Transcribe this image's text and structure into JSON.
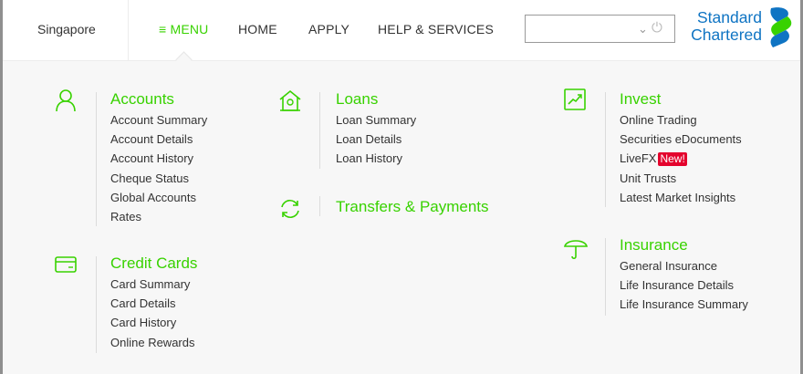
{
  "header": {
    "region": "Singapore",
    "menu_label": "≡ MENU",
    "home_label": "HOME",
    "apply_label": "APPLY",
    "help_label": "HELP & SERVICES",
    "select_value": "",
    "logo_line1": "Standard",
    "logo_line2": "Chartered"
  },
  "accounts": {
    "title": "Accounts",
    "items": [
      "Account Summary",
      "Account Details",
      "Account History",
      "Cheque Status",
      "Global Accounts",
      "Rates"
    ]
  },
  "credit_cards": {
    "title": "Credit Cards",
    "items": [
      "Card Summary",
      "Card Details",
      "Card History",
      "Online Rewards"
    ]
  },
  "loans": {
    "title": "Loans",
    "items": [
      "Loan Summary",
      "Loan Details",
      "Loan History"
    ]
  },
  "transfers": {
    "title": "Transfers & Payments"
  },
  "invest": {
    "title": "Invest",
    "items": [
      "Online Trading",
      "Securities eDocuments",
      "LiveFX",
      "Unit Trusts",
      "Latest Market Insights"
    ],
    "new_badge": "New!"
  },
  "insurance": {
    "title": "Insurance",
    "items": [
      "General Insurance",
      "Life Insurance Details",
      "Life Insurance Summary"
    ]
  },
  "colors": {
    "accent_green": "#38d200",
    "brand_blue": "#0f74c3",
    "badge_red": "#e4032d"
  },
  "icons": [
    "user-icon",
    "card-icon",
    "house-icon",
    "transfer-icon",
    "chart-icon",
    "umbrella-icon",
    "power-icon",
    "chevron-down-icon"
  ]
}
